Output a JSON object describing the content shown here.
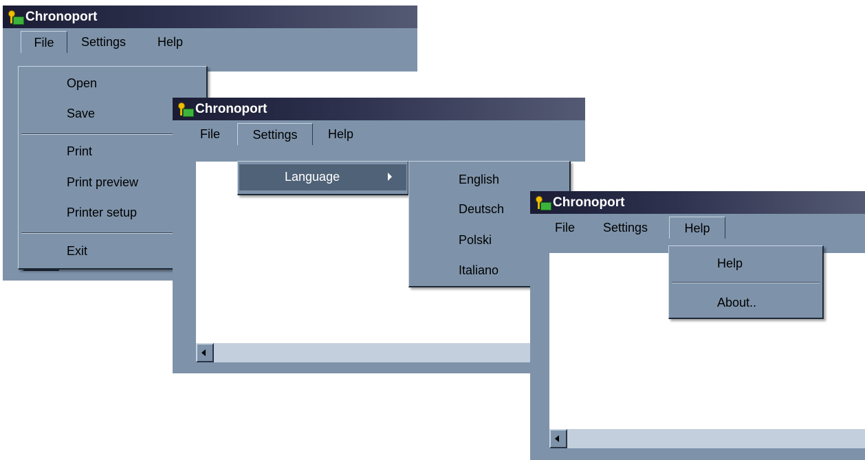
{
  "app_title": "Chronoport",
  "menubar": {
    "file": "File",
    "settings": "Settings",
    "help": "Help"
  },
  "file_menu": {
    "open": "Open",
    "save": "Save",
    "print": "Print",
    "print_preview": "Print preview",
    "printer_setup": "Printer setup",
    "exit": "Exit"
  },
  "settings_menu": {
    "language": "Language"
  },
  "language_menu": {
    "english": "English",
    "deutsch": "Deutsch",
    "polski": "Polski",
    "italiano": "Italiano"
  },
  "help_menu": {
    "help": "Help",
    "about": "About.."
  },
  "colors": {
    "window_bg": "#7e93aa",
    "titlebar_dark": "#1a1c34",
    "highlight": "#4f6278"
  },
  "icons": {
    "app_icon": "key-and-folder-icon",
    "scroll_left": "arrow-left-icon",
    "submenu": "submenu-arrow-icon"
  }
}
